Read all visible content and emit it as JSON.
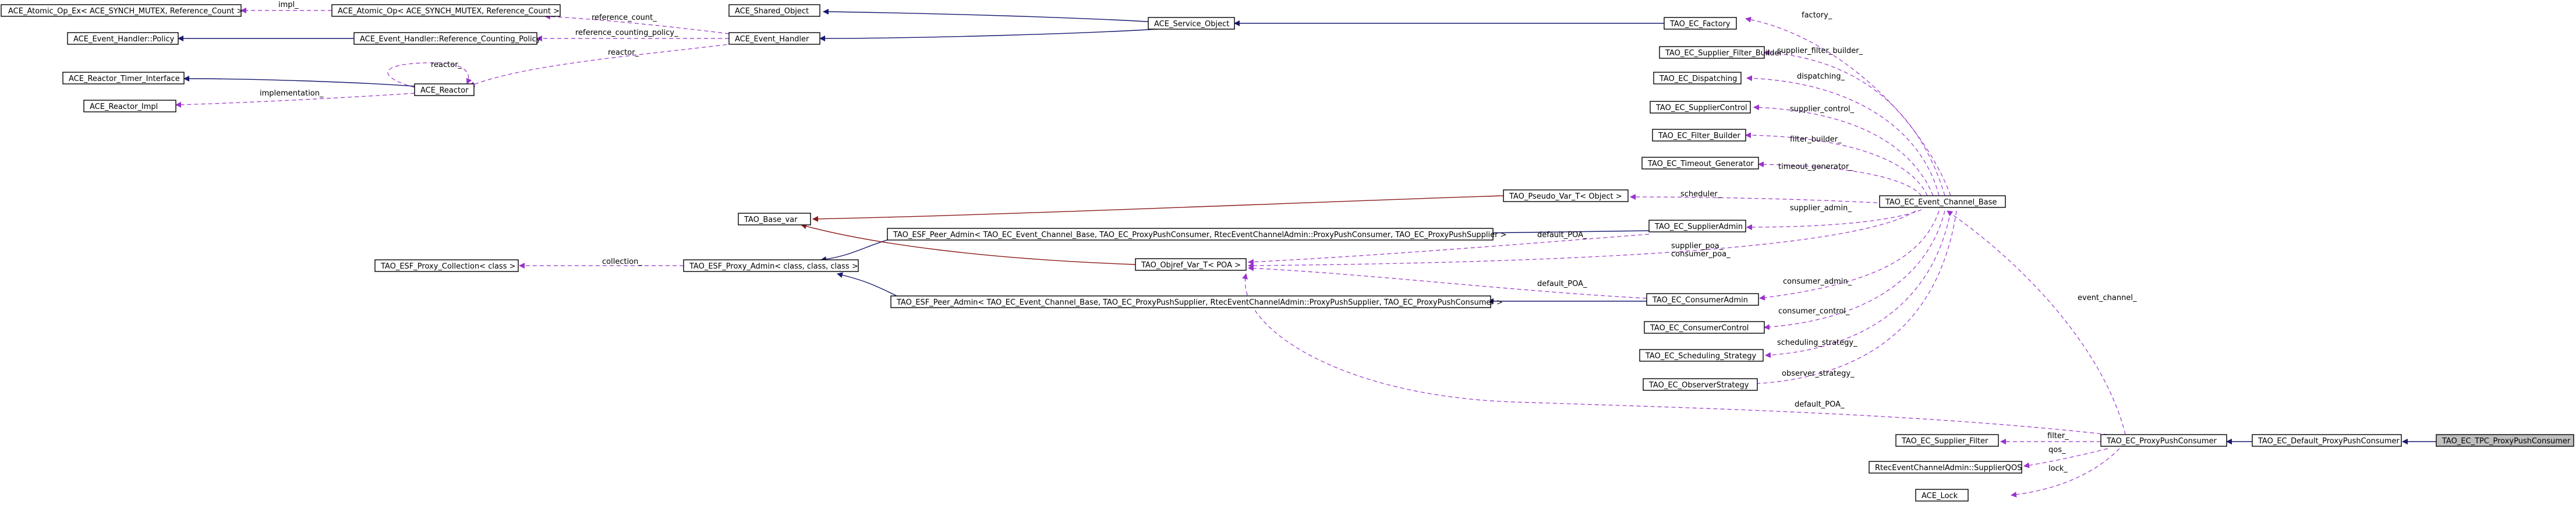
{
  "nodes": {
    "n_atomic_ex": "ACE_Atomic_Op_Ex< ACE_SYNCH_MUTEX, Reference_Count >",
    "n_atomic": "ACE_Atomic_Op< ACE_SYNCH_MUTEX, Reference_Count >",
    "n_shared": "ACE_Shared_Object",
    "n_service": "ACE_Service_Object",
    "n_factory": "TAO_EC_Factory",
    "n_policy": "ACE_Event_Handler::Policy",
    "n_refpolicy": "ACE_Event_Handler::Reference_Counting_Policy",
    "n_handler": "ACE_Event_Handler",
    "n_sfb": "TAO_EC_Supplier_Filter_Builder",
    "n_timer": "ACE_Reactor_Timer_Interface",
    "n_reactor": "ACE_Reactor",
    "n_dispatching": "TAO_EC_Dispatching",
    "n_rimpl": "ACE_Reactor_Impl",
    "n_supctrl": "TAO_EC_SupplierControl",
    "n_fb": "TAO_EC_Filter_Builder",
    "n_tgen": "TAO_EC_Timeout_Generator",
    "n_pseudo": "TAO_Pseudo_Var_T< Object >",
    "n_ecbase": "TAO_EC_Event_Channel_Base",
    "n_basevar": "TAO_Base_var",
    "n_supadmin": "TAO_EC_SupplierAdmin",
    "n_peer1": "TAO_ESF_Peer_Admin< TAO_EC_Event_Channel_Base, TAO_EC_ProxyPushConsumer, RtecEventChannelAdmin::ProxyPushConsumer, TAO_EC_ProxyPushSupplier >",
    "n_collection": "TAO_ESF_Proxy_Collection< class >",
    "n_proxyadmin": "TAO_ESF_Proxy_Admin< class, class, class >",
    "n_objvar": "TAO_Objref_Var_T< POA >",
    "n_consadmin": "TAO_EC_ConsumerAdmin",
    "n_peer2": "TAO_ESF_Peer_Admin< TAO_EC_Event_Channel_Base, TAO_EC_ProxyPushSupplier, RtecEventChannelAdmin::ProxyPushSupplier, TAO_EC_ProxyPushConsumer >",
    "n_consctrl": "TAO_EC_ConsumerControl",
    "n_sched": "TAO_EC_Scheduling_Strategy",
    "n_observer": "TAO_EC_ObserverStrategy",
    "n_supfilter": "TAO_EC_Supplier_Filter",
    "n_ppc": "TAO_EC_ProxyPushConsumer",
    "n_defppc": "TAO_EC_Default_ProxyPushConsumer",
    "n_tpcppc": "TAO_EC_TPC_ProxyPushConsumer",
    "n_qos": "RtecEventChannelAdmin::SupplierQOS",
    "n_lock": "ACE_Lock"
  },
  "edge_labels": {
    "l_impl": "impl_",
    "l_refcount": "reference_count_",
    "l_refpolicy": "reference_counting_policy_",
    "l_reactor1": "reactor_",
    "l_reactor2": "reactor_",
    "l_implementation": "implementation_",
    "l_factory": "factory_",
    "l_sfb": "supplier_filter_builder_",
    "l_dispatching": "dispatching_",
    "l_supctrl": "supplier_control_",
    "l_fb": "filter_builder_",
    "l_tgen": "timeout_generator_",
    "l_scheduler": "scheduler_",
    "l_supadmin": "supplier_admin_",
    "l_defpoa1": "default_POA_",
    "l_collection": "collection_",
    "l_poa": "supplier_poa_\nconsumer_poa_",
    "l_defpoa2": "default_POA_",
    "l_consadmin": "consumer_admin_",
    "l_consctrl": "consumer_control_",
    "l_sched": "scheduling_strategy_",
    "l_observer": "observer_strategy_",
    "l_defpoa3": "default_POA_",
    "l_evchannel": "event_channel_",
    "l_filter": "filter_",
    "l_qos": "qos_",
    "l_lock": "lock_"
  },
  "colors": {
    "inheritance": "#191970",
    "template": "#8b1a1a",
    "usage": "#9a32cd",
    "highlight_fill": "#bfbfbf"
  }
}
